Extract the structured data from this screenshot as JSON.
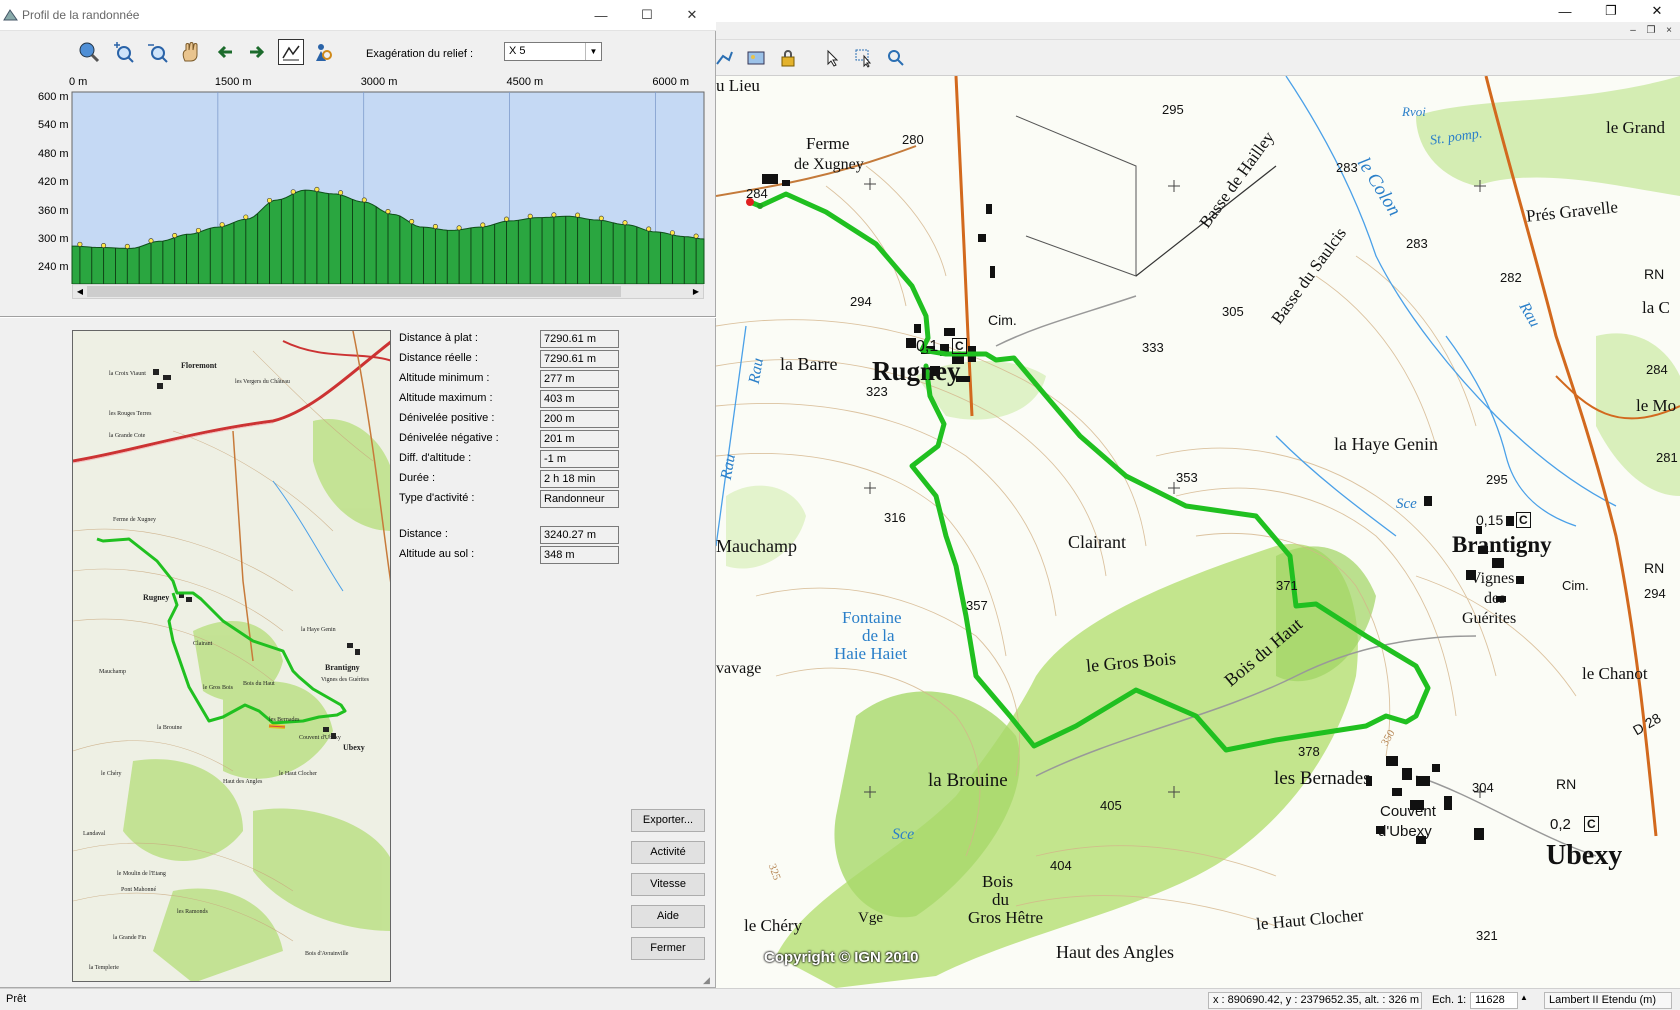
{
  "app": {
    "minimize": "—",
    "restore": "❐",
    "close": "✕",
    "mdi_minimize": "–",
    "mdi_restore": "❐",
    "mdi_close": "×",
    "toolbar_icons": [
      "route-icon",
      "image-icon",
      "lock-icon",
      "pointer-icon",
      "select-rect-icon",
      "zoom-pointer-icon"
    ]
  },
  "dialog": {
    "title": "Profil de la randonnée",
    "toolbar_icons": [
      "globe-zoom-icon",
      "zoom-in-icon",
      "zoom-out-icon",
      "pan-hand-icon",
      "arrow-left-icon",
      "arrow-right-icon",
      "profile-mode-icon",
      "search-person-icon"
    ],
    "relief_label": "Exagération du relief :",
    "relief_value": "X 5",
    "x_ticks": [
      "0 m",
      "1500 m",
      "3000 m",
      "4500 m",
      "6000 m"
    ],
    "y_ticks": [
      "600 m",
      "540 m",
      "480 m",
      "420 m",
      "360 m",
      "300 m",
      "240 m"
    ],
    "stats": [
      {
        "label": "Distance à plat :",
        "value": "7290.61 m"
      },
      {
        "label": "Distance réelle :",
        "value": "7290.61 m"
      },
      {
        "label": "Altitude minimum :",
        "value": "277 m"
      },
      {
        "label": "Altitude maximum :",
        "value": "403 m"
      },
      {
        "label": "Dénivelée positive :",
        "value": "200 m"
      },
      {
        "label": "Dénivelée négative :",
        "value": "201 m"
      },
      {
        "label": "Diff. d'altitude :",
        "value": "-1 m"
      },
      {
        "label": "Durée :",
        "value": "2 h 18 min"
      },
      {
        "label": "Type d'activité :",
        "value": "Randonneur"
      },
      {
        "label": "Distance :",
        "value": "3240.27 m"
      },
      {
        "label": "Altitude au sol :",
        "value": "348 m"
      }
    ],
    "buttons": {
      "export": "Exporter...",
      "activity": "Activité",
      "speed": "Vitesse",
      "help": "Aide",
      "close": "Fermer"
    }
  },
  "profile_data": {
    "x_max_m": 6500,
    "y_range_m": [
      205,
      610
    ],
    "distance_m": [
      0,
      300,
      600,
      900,
      1200,
      1500,
      1800,
      2100,
      2400,
      2700,
      3000,
      3300,
      3600,
      3900,
      4200,
      4500,
      4800,
      5100,
      5400,
      5700,
      6000,
      6300,
      6500
    ],
    "altitude_m": [
      285,
      282,
      280,
      295,
      310,
      325,
      342,
      382,
      403,
      395,
      378,
      352,
      325,
      318,
      325,
      338,
      345,
      348,
      340,
      330,
      315,
      305,
      300
    ]
  },
  "minimap": {
    "labels": [
      "Floremont",
      "les Vergers du Château",
      "la Croix Viaunt",
      "les Rouges Terres",
      "la Grande Cote",
      "Ferme de Xugney",
      "Rugney",
      "Clairant",
      "Brantigny",
      "Vignes des Guérites",
      "la Haye Genin",
      "le Gros Bois",
      "Bois du Haut",
      "la Brouine",
      "les Bernades",
      "Couvent d'Ubexy",
      "Ubexy",
      "le Haut Clocher",
      "Haut des Angles",
      "Mauchamp",
      "le Chéry",
      "Landaval",
      "le Moulin de l'Etang",
      "Pont Mahonné",
      "les Ramonds",
      "la Grande Fin",
      "la Templerie",
      "Bois d'Avrainville"
    ]
  },
  "map": {
    "copyright": "Copyright © IGN 2010",
    "labels": {
      "lieu": "u Lieu",
      "ferme": "Ferme",
      "xugney": "de Xugney",
      "rugney": "Rugney",
      "rugney_pop": "0,1",
      "c1": "C",
      "cim1": "Cim.",
      "la_barre": "la Barre",
      "clairant": "Clairant",
      "mauchamp": "Mauchamp",
      "fontaine1": "Fontaine",
      "fontaine2": "de la",
      "fontaine3": "Haie Haiet",
      "vavage": "vavage",
      "le_gros_bois": "le Gros Bois",
      "bois_du_haut": "Bois du Haut",
      "la_brouine": "la Brouine",
      "les_bernades": "les Bernades",
      "couvent1": "Couvent",
      "couvent2": "d'Ubexy",
      "ubexy": "Ubexy",
      "ubexy_pop": "0,2",
      "c2": "C",
      "brantigny": "Brantigny",
      "brantigny_pop": "0,15",
      "c3": "C",
      "vignes1": "Vignes",
      "vignes2": "des",
      "vignes3": "Guérites",
      "cim2": "Cim.",
      "la_haye_genin": "la Haye Genin",
      "le_chanot": "le Chanot",
      "pres_gravelle": "Prés Gravelle",
      "le_grand": "le Grand",
      "basse_hailley": "Basse de Hailley",
      "basse_saulcis": "Basse du Saulcis",
      "le_colon": "le Colon",
      "rau1": "Rau",
      "rau2": "Rau",
      "rau3": "Rau",
      "rvoi": "Rvoi",
      "st_pomp": "St. pomp.",
      "sce1": "Sce",
      "sce2": "Sce",
      "bois_gros_hetre1": "Bois",
      "bois_gros_hetre2": "du",
      "bois_gros_hetre3": "Gros Hêtre",
      "haut_des_angles": "Haut des Angles",
      "le_haut_clocher": "le Haut Clocher",
      "le_chery": "le Chéry",
      "vge": "Vge",
      "rn1": "RN",
      "rn2": "RN",
      "rn3": "RN",
      "d28": "D 28",
      "le_mo": "le Mo",
      "la_c": "la C",
      "a280": "280",
      "a284": "284",
      "a295": "295",
      "a283a": "283",
      "a283b": "283",
      "a282": "282",
      "a305": "305",
      "a294a": "294",
      "a323": "323",
      "a333": "333",
      "a353": "353",
      "a316": "316",
      "a357": "357",
      "a371": "371",
      "a378": "378",
      "a304": "304",
      "a405": "405",
      "a404": "404",
      "a321": "321",
      "a295b": "295",
      "a294b": "294",
      "a284b": "284",
      "a281": "281",
      "a325": "325",
      "a350": "350"
    }
  },
  "statusbar": {
    "ready": "Prêt",
    "coords": "x : 890690.42, y : 2379652.35, alt. : 326 m",
    "scale_label": "Ech. 1:",
    "scale_value": "11628",
    "projection": "Lambert II Etendu (m)"
  }
}
